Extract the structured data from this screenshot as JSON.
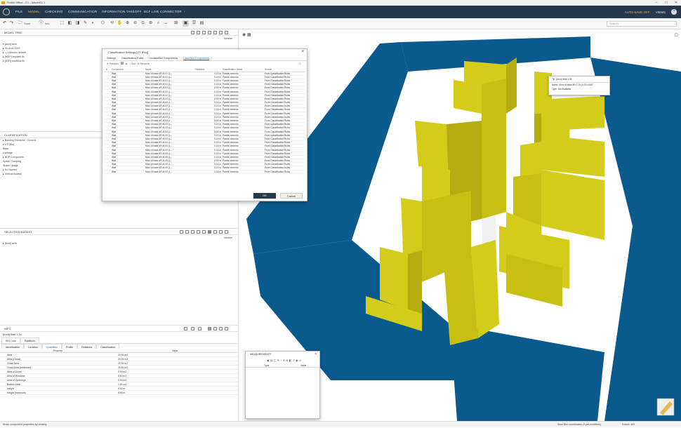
{
  "window": {
    "title": "Solibri Office - C:\\...\\Model01.1"
  },
  "menu": {
    "items": [
      "FILE",
      "MODEL",
      "CHECKING",
      "COMMUNICATION",
      "INFORMATION TAKEOFF",
      "BCF LIVE CONNECTOR"
    ],
    "active": "MODEL",
    "right_badge": "AUTO-SAVE OFF",
    "views": "VIEWS",
    "help": "?"
  },
  "toolbar": {
    "save": "Save",
    "info": "Info",
    "search_placeholder": "Search"
  },
  "model_tree": {
    "title": "MODEL TREE",
    "version": "Version",
    "items": [
      "▾ [Arch] arch",
      "  ▸ 00-Arch-0007",
      "    ▸ ▭ Ubicchio default",
      "▸ [MEP] impianti.ifc",
      "▸ [STR] struttura.ifc"
    ]
  },
  "classification": {
    "title": "CLASSIFICATION",
    "items": [
      "▸ Building Elements - Generic",
      "▾ CT (Blu)",
      "    Base",
      "    Garbage",
      "▸ BDP Component",
      "    Space Grouping",
      "    Space Usage",
      "▸ Un Named",
      "▸ Vertical Access"
    ]
  },
  "selection_basket": {
    "title": "SELECTION BASKET",
    "version": "Version",
    "items": [
      "▸ [Arch] arch"
    ]
  },
  "info": {
    "title": "INFO",
    "element": "[Arch] Wall 1.34",
    "tabs": [
      "BIM Data",
      "Relations"
    ],
    "subtabs": [
      "Identification",
      "Location",
      "Quantities",
      "Profile",
      "Relations",
      "Classification"
    ],
    "active_subtab": "Quantities",
    "col_property": "Property",
    "col_value": "Value",
    "rows": [
      [
        "Area",
        "20.91 m2"
      ],
      [
        "Area (Gross)",
        "20.91 m2"
      ],
      [
        "Gross Area",
        "20.91 m2"
      ],
      [
        "Gross Area (minimum)",
        "20.91 m2"
      ],
      [
        "Area of Doors",
        "0.00 m2"
      ],
      [
        "Area of Windows",
        "0.00 m2"
      ],
      [
        "Area of Openings",
        "0.00 m2"
      ],
      [
        "Bottom Area",
        "1.01 m2"
      ],
      [
        "Height",
        "4.00 m"
      ],
      [
        "Height (minimum)",
        "4.00 m"
      ]
    ]
  },
  "dialog": {
    "title": "Classification Settings [CT (Blu)]",
    "tabs": [
      "Settings",
      "Classification Rules",
      "Unclassified Components",
      "Classified Components"
    ],
    "active_tab": "Classified Components",
    "refresh": "Refresh",
    "sort": "Sort",
    "remove": "Remove",
    "columns": [
      "#",
      "Component",
      "Name",
      "Thickness",
      "Classification Name",
      "Source"
    ],
    "rows": [
      [
        "Wall",
        "Muro di base AR-M-01 (L...",
        "0.15 m",
        "Parete cemento",
        "From Classification Rules"
      ],
      [
        "Wall",
        "Muro di base AR-M-01 (L...",
        "0.15 m",
        "Parete cemento",
        "From Classification Rules"
      ],
      [
        "Wall",
        "Muro di base AR-M-01 (L...",
        "0.15 m",
        "Parete cemento",
        "From Classification Rules"
      ],
      [
        "Wall",
        "Muro di base AR-M-01 (L...",
        "0.15 m",
        "Parete cemento",
        "From Classification Rules"
      ],
      [
        "Wall",
        "Muro di base AR-M-02 (L...",
        "0.15 m",
        "Parete cemento",
        "From Classification Rules"
      ],
      [
        "Wall",
        "Muro di base AR-M-02 (L...",
        "0.15 m",
        "Parete cemento",
        "From Classification Rules"
      ],
      [
        "Wall",
        "Muro di base AR-M-02 (L...",
        "0.15 m",
        "Parete cemento",
        "From Classification Rules"
      ],
      [
        "Wall",
        "Muro di base AR-M-02 (L...",
        "0.15 m",
        "Parete cemento",
        "From Classification Rules"
      ],
      [
        "Wall",
        "Muro di base AR-M-02 (L...",
        "0.15 m",
        "Parete cemento",
        "From Classification Rules"
      ],
      [
        "Wall",
        "Muro di base AR-M-02 (L...",
        "0.15 m",
        "Parete cemento",
        "From Classification Rules"
      ],
      [
        "Wall",
        "Muro di base AR-M-03 (L...",
        "0.15 m",
        "Parete cemento",
        "From Classification Rules"
      ],
      [
        "Wall",
        "Muro di base AR-M-03 (L...",
        "0.15 m",
        "Parete cemento",
        "From Classification Rules"
      ],
      [
        "Wall",
        "Muro di base AR-M-03 (L...",
        "0.15 m",
        "Parete cemento",
        "From Classification Rules"
      ],
      [
        "Wall",
        "Muro di base AR-M-03 (L...",
        "0.15 m",
        "Parete cemento",
        "From Classification Rules"
      ],
      [
        "Wall",
        "Muro di base AR-M-03 (L...",
        "0.15 m",
        "Parete cemento",
        "From Classification Rules"
      ],
      [
        "Wall",
        "Muro di base AR-M-03 (L...",
        "0.15 m",
        "Parete cemento",
        "From Classification Rules"
      ],
      [
        "Wall",
        "Muro di base AR-M-04 (L...",
        "0.15 m",
        "Parete cemento",
        "From Classification Rules"
      ],
      [
        "Wall",
        "Muro di base AR-M-04 (L...",
        "0.15 m",
        "Parete cemento",
        "From Classification Rules"
      ],
      [
        "Wall",
        "Muro di base AR-M-04 (L...",
        "0.15 m",
        "Parete cemento",
        "From Classification Rules"
      ],
      [
        "Wall",
        "Muro di base AR-M-04 (L...",
        "0.15 m",
        "Parete cemento",
        "From Classification Rules"
      ],
      [
        "Wall",
        "Muro di base AR-M-04 (L...",
        "0.15 m",
        "Parete cemento",
        "From Classification Rules"
      ],
      [
        "Wall",
        "Muro di base AR-M-04 (L...",
        "0.15 m",
        "Parete cemento",
        "From Classification Rules"
      ],
      [
        "Wall",
        "Muro di base AR-M-05 (L...",
        "0.15 m",
        "Parete cemento",
        "From Classification Rules"
      ],
      [
        "Wall",
        "Muro di base AR-M-05 (L...",
        "0.15 m",
        "Parete cemento",
        "From Classification Rules"
      ],
      [
        "Wall",
        "Muro di base AR-M-05 (L...",
        "0.15 m",
        "Parete cemento",
        "From Classification Rules"
      ],
      [
        "Wall",
        "Muro di base AR-M-05 (L...",
        "0.15 m",
        "Parete cemento",
        "From Classification Rules"
      ],
      [
        "Wall",
        "Muro di base AR-M-05 (L...",
        "0.15 m",
        "Parete cemento",
        "From Classification Rules"
      ],
      [
        "Wall",
        "Muro di base AR-M-05 (L...",
        "0.15 m",
        "Parete cemento",
        "From Classification Rules"
      ]
    ],
    "ok": "OK",
    "cancel": "Cancel"
  },
  "tooltip": {
    "title": "Tip: [Arch] Wall 1.34",
    "name_label": "Name",
    "name_value": "Muro di base AR-T-01 (0.20) 0067",
    "type_label": "Type",
    "type_value": "Not Available"
  },
  "floating": {
    "title": "MEASUREMENTS",
    "col_type": "Type",
    "col_value": "Value"
  },
  "status": {
    "left": "Show component properties by clicking",
    "right": "Slow Bim coordinates (0 pre-modifiers)",
    "extent": "Extent: 100"
  },
  "colors": {
    "menu_bg": "#25384c",
    "accent": "#e8b84a",
    "wall_blue": "#0a5a8e",
    "wall_yellow": "#d4cc1a"
  }
}
